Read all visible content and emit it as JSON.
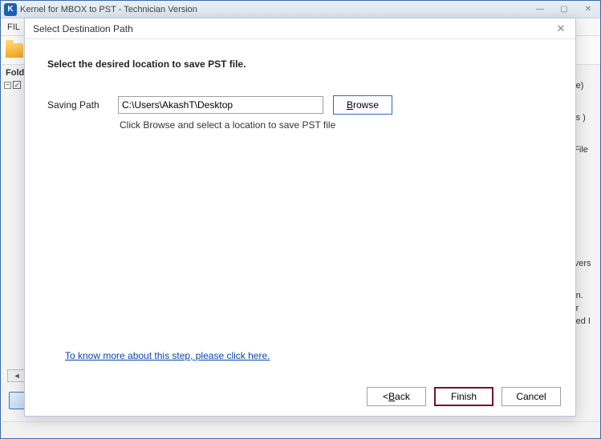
{
  "parent": {
    "title": "Kernel for MBOX to PST - Technician Version",
    "menu_file": "FIL",
    "left_panel_title": "Folde",
    "win_min": "—",
    "win_max": "▢",
    "win_close": "✕",
    "tree_expand": "−",
    "tree_check": "✓",
    "scroll_left": "◄"
  },
  "right_fragments": [
    "File)",
    "ess )",
    "e File",
    "ervers",
    "min.",
    "ver",
    "ased I"
  ],
  "dialog": {
    "title": "Select Destination Path",
    "close": "✕",
    "instruction": "Select the desired location to save PST file.",
    "path_label": "Saving Path",
    "path_value": "C:\\Users\\AkashT\\Desktop",
    "browse_pre": "B",
    "browse_rest": "rowse",
    "hint": "Click Browse and select a location to save PST file",
    "help_link": "To know more about this step, please click here.",
    "back_prefix": "< ",
    "back_u": "B",
    "back_rest": "ack",
    "finish": "Finish",
    "cancel": "Cancel"
  }
}
